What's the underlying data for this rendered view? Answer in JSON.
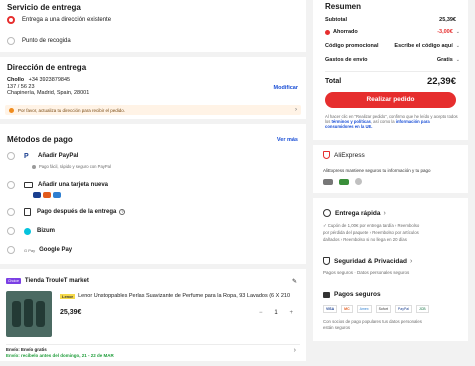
{
  "shipping_service": {
    "title": "Servicio de entrega",
    "options": [
      {
        "label": "Entrega a una dirección existente",
        "selected": true
      },
      {
        "label": "Punto de recogida",
        "selected": false
      }
    ]
  },
  "address": {
    "title": "Dirección de entrega",
    "name": "Chollo",
    "phone": "+34 3923879845",
    "line1": "137 / 56 23",
    "line2": "Chapinería, Madrid, Spain, 28001",
    "edit_label": "Modificar",
    "warning": "Por favor, actualiza tu dirección para recibir el pedido."
  },
  "payment": {
    "title": "Métodos de pago",
    "see_more": "Ver más",
    "methods": [
      {
        "label": "Añadir PayPal",
        "sub": "Pago fácil, rápido y seguro con PayPal",
        "icon": "paypal-icon"
      },
      {
        "label": "Añadir una tarjeta nueva",
        "sub": "",
        "icon": "credit-card-icon"
      },
      {
        "label": "Pago después de la entrega",
        "sub": "",
        "icon": "pay-later-icon"
      },
      {
        "label": "Bizum",
        "sub": "",
        "icon": "bizum-icon"
      },
      {
        "label": "Google Pay",
        "sub": "",
        "icon": "google-pay-icon"
      }
    ]
  },
  "store": {
    "badge": "Choice",
    "name": "Tienda TrouleT market",
    "item_tag": "Lenor",
    "item_title": "Lenor Unstoppables Perlas Suavizante de Perfume para la Ropa, 93 Lavados (6 X 210",
    "price": "25,39€",
    "quantity": "1",
    "minus": "−",
    "plus": "+",
    "shipping_line1": "Envío: Envío gratis",
    "shipping_line2": "Envío: recíbelo antes del domingo, 21 - 22 de MAR"
  },
  "summary": {
    "title": "Resumen",
    "subtotal_label": "Subtotal",
    "subtotal_value": "25,39€",
    "saved_label": "Ahorrado",
    "saved_value": "-3,00€",
    "promo_label": "Código promocional",
    "promo_value": "Escribe el código aquí",
    "shipping_label": "Gastos de envío",
    "shipping_value": "Gratis",
    "total_label": "Total",
    "total_value": "22,39€",
    "cta": "Realizar pedido",
    "legal_1": "Al hacer clic en \"Realizar pedido\", confirmo que he leído y",
    "legal_2": "acepto todos los",
    "legal_terms": "términos y políticas",
    "legal_3": ", así como la",
    "legal_info": "información para consumidores en la UE."
  },
  "trust": {
    "brand": "AliExpress",
    "text": "AliExpress mantiene seguros tu información y tu pago",
    "fast_title": "Entrega rápida",
    "fast_line1": "✓ Cupón de 1,00€ por entrega tardía  ›  Reembolso",
    "fast_line2": "por pérdida del paquete  ›  Reembolso por artículos",
    "fast_line3": "dañados  ›  Reembolso si no llega en 20 días",
    "security_title": "Seguridad & Privacidad",
    "security_text": "Pagos seguros · Datos personales seguros",
    "payments_title": "Pagos seguros",
    "payment_logos": [
      "VISA",
      "MC",
      "Amex",
      "Sofort",
      "PayPal",
      "JCB"
    ],
    "payments_text_1": "Con socios de pago populares tus datos personales",
    "payments_text_2": "están seguros"
  },
  "colors": {
    "accent": "#e62e2e",
    "link": "#1a4fd6",
    "success": "#1f9d3a"
  }
}
